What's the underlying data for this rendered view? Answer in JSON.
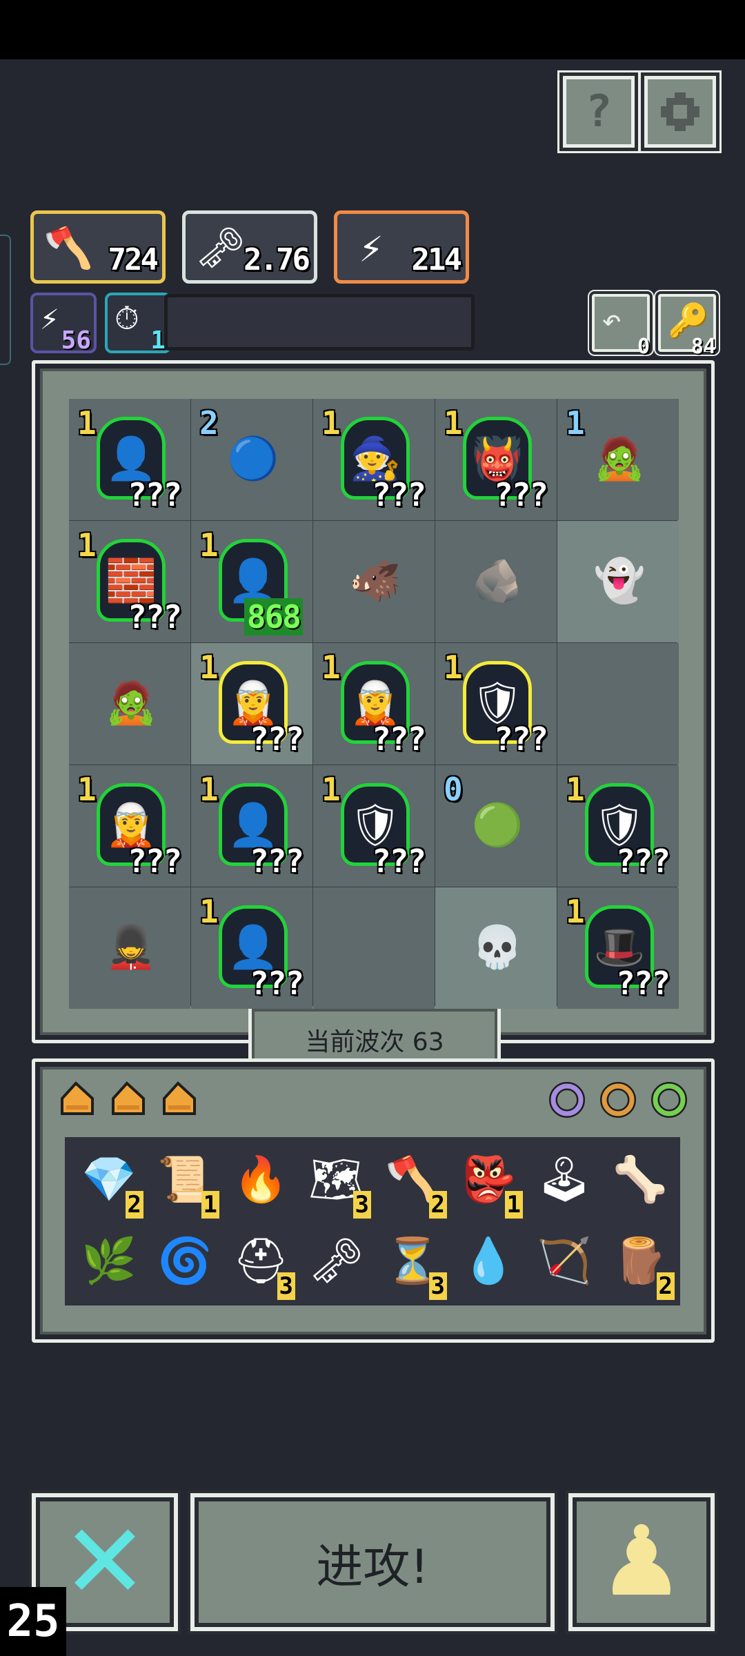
{
  "top_buttons": {
    "help_glyph": "?",
    "settings_icon": "gear-icon"
  },
  "resources": [
    {
      "icon": "axe-icon",
      "glyph": "🪓",
      "value": "724",
      "border": "#e9c64e"
    },
    {
      "icon": "key-icon",
      "glyph": "🗝",
      "value": "2.76",
      "border": "#d8e3e0"
    },
    {
      "icon": "lightning-icon",
      "glyph": "⚡",
      "value": "214",
      "border": "#f28b45"
    }
  ],
  "small_resources": [
    {
      "icon": "lightning-icon",
      "glyph": "⚡",
      "value": "56",
      "border": "#5a54a3"
    },
    {
      "icon": "timer-icon",
      "glyph": "⏱",
      "value": "1",
      "border": "#2aa7b8"
    }
  ],
  "counters": [
    {
      "icon": "undo-icon",
      "glyph": "↶",
      "value": "0"
    },
    {
      "icon": "key-icon",
      "glyph": "🔑",
      "value": "84"
    }
  ],
  "grid": [
    {
      "level": "1",
      "sprite": "👤",
      "count": "???",
      "frame": "green"
    },
    {
      "level": "2",
      "sprite": "🔵",
      "count": "",
      "frame": "none",
      "level_color": "blue"
    },
    {
      "level": "1",
      "sprite": "🧙",
      "count": "???",
      "frame": "green"
    },
    {
      "level": "1",
      "sprite": "👹",
      "count": "???",
      "frame": "green"
    },
    {
      "level": "1",
      "sprite": "🧟",
      "count": "",
      "frame": "none",
      "level_color": "blue"
    },
    {
      "level": "1",
      "sprite": "🧱",
      "count": "???",
      "frame": "green"
    },
    {
      "level": "1",
      "sprite": "👤",
      "count": "868",
      "frame": "green",
      "count_style": "green"
    },
    {
      "level": "",
      "sprite": "🐗",
      "count": "",
      "frame": "none"
    },
    {
      "level": "",
      "sprite": "🪨",
      "count": "",
      "frame": "none"
    },
    {
      "level": "",
      "sprite": "👻",
      "count": "",
      "frame": "none",
      "light": true
    },
    {
      "level": "",
      "sprite": "🧟",
      "count": "",
      "frame": "none"
    },
    {
      "level": "1",
      "sprite": "🧝",
      "count": "???",
      "frame": "yellow",
      "light": true
    },
    {
      "level": "1",
      "sprite": "🧝",
      "count": "???",
      "frame": "green"
    },
    {
      "level": "1",
      "sprite": "🛡",
      "count": "???",
      "frame": "yellow"
    },
    {
      "level": "",
      "sprite": "",
      "count": "",
      "frame": "none"
    },
    {
      "level": "1",
      "sprite": "🧝",
      "count": "???",
      "frame": "green"
    },
    {
      "level": "1",
      "sprite": "👤",
      "count": "???",
      "frame": "green"
    },
    {
      "level": "1",
      "sprite": "🛡",
      "count": "???",
      "frame": "green"
    },
    {
      "level": "0",
      "sprite": "🟢",
      "count": "",
      "frame": "none",
      "level_color": "blue"
    },
    {
      "level": "1",
      "sprite": "🛡",
      "count": "???",
      "frame": "green"
    },
    {
      "level": "",
      "sprite": "💂",
      "count": "",
      "frame": "none"
    },
    {
      "level": "1",
      "sprite": "👤",
      "count": "???",
      "frame": "green"
    },
    {
      "level": "",
      "sprite": "",
      "count": "",
      "frame": "none"
    },
    {
      "level": "",
      "sprite": "💀",
      "count": "",
      "frame": "none",
      "light": true
    },
    {
      "level": "1",
      "sprite": "🎩",
      "count": "???",
      "frame": "green"
    }
  ],
  "wave_label": "当前波次 63",
  "inventory_tabs": {
    "left": [
      "cheese-icon",
      "cheese-icon",
      "cheese-icon"
    ],
    "right": [
      "ring-purple-icon",
      "ring-orange-icon",
      "ring-green-icon"
    ]
  },
  "inventory": [
    {
      "name": "heart-gem-icon",
      "glyph": "💎",
      "n": "2"
    },
    {
      "name": "scroll-icon",
      "glyph": "📜",
      "n": "1"
    },
    {
      "name": "fire-icon",
      "glyph": "🔥",
      "n": ""
    },
    {
      "name": "map-icon",
      "glyph": "🗺",
      "n": "3"
    },
    {
      "name": "axe-icon",
      "glyph": "🪓",
      "n": "2"
    },
    {
      "name": "demon-mask-icon",
      "glyph": "👺",
      "n": "1"
    },
    {
      "name": "lever-icon",
      "glyph": "🕹",
      "n": ""
    },
    {
      "name": "claw-icon",
      "glyph": "🦴",
      "n": ""
    },
    {
      "name": "grass-icon",
      "glyph": "🌿",
      "n": ""
    },
    {
      "name": "wind-icon",
      "glyph": "🌀",
      "n": ""
    },
    {
      "name": "helmet-icon",
      "glyph": "⛑",
      "n": "3"
    },
    {
      "name": "key-icon",
      "glyph": "🗝",
      "n": ""
    },
    {
      "name": "hourglass-icon",
      "glyph": "⏳",
      "n": "3"
    },
    {
      "name": "drop-icon",
      "glyph": "💧",
      "n": ""
    },
    {
      "name": "arrow-icon",
      "glyph": "🏹",
      "n": ""
    },
    {
      "name": "log-icon",
      "glyph": "🪵",
      "n": "2"
    }
  ],
  "actions": {
    "close_glyph": "✕",
    "attack_label": "进攻!",
    "pawn_glyph": "♟"
  },
  "corner_number": "25"
}
